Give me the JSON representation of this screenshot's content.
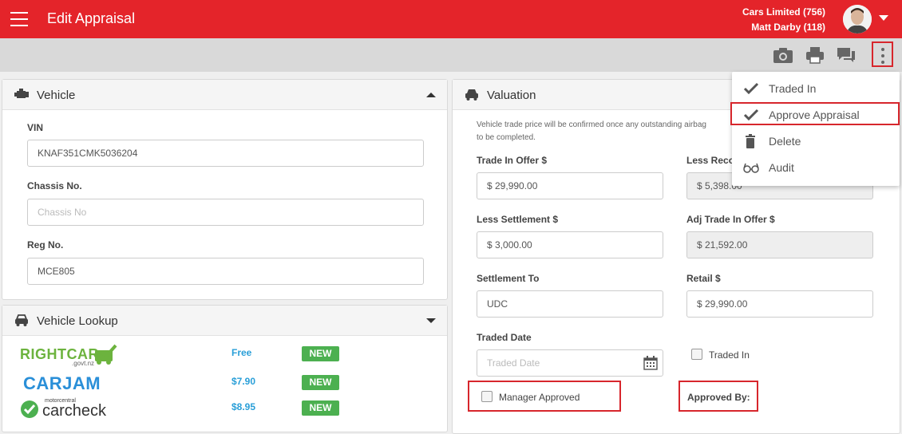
{
  "header": {
    "title": "Edit Appraisal",
    "company": "Cars Limited (756)",
    "user": "Matt Darby (118)"
  },
  "toolbar": {
    "icons": [
      "camera-icon",
      "print-icon",
      "comments-icon",
      "more-vertical-icon"
    ]
  },
  "vehicle": {
    "title": "Vehicle",
    "vin_label": "VIN",
    "vin_value": "KNAF351CMK5036204",
    "chassis_label": "Chassis No.",
    "chassis_placeholder": "Chassis No",
    "reg_label": "Reg No.",
    "reg_value": "MCE805"
  },
  "lookup": {
    "title": "Vehicle Lookup",
    "providers": [
      {
        "name": "RIGHTCAR",
        "sub": ".govt.nz",
        "price": "Free",
        "badge": "NEW"
      },
      {
        "name": "CARJAM",
        "price": "$7.90",
        "badge": "NEW"
      },
      {
        "name": "carcheck",
        "sub": "motorcentral",
        "price": "$8.95",
        "badge": "NEW"
      }
    ]
  },
  "valuation": {
    "title": "Valuation",
    "note_line1": "Vehicle trade price will be confirmed once any outstanding airbag",
    "note_line2": "to be completed.",
    "trade_in_offer_label": "Trade In Offer $",
    "trade_in_offer_value": "$ 29,990.00",
    "less_recon_label": "Less Reco",
    "less_recon_value": "$ 5,398.00",
    "less_settlement_label": "Less Settlement $",
    "less_settlement_value": "$ 3,000.00",
    "adj_trade_label": "Adj Trade In Offer $",
    "adj_trade_value": "$ 21,592.00",
    "settlement_to_label": "Settlement To",
    "settlement_to_value": "UDC",
    "retail_label": "Retail $",
    "retail_value": "$ 29,990.00",
    "traded_date_label": "Traded Date",
    "traded_date_placeholder": "Traded Date",
    "traded_in_label": "Traded In",
    "manager_approved_label": "Manager Approved",
    "approved_by_label": "Approved By:"
  },
  "menu": {
    "items": [
      {
        "label": "Traded In",
        "icon": "check-icon"
      },
      {
        "label": "Approve Appraisal",
        "icon": "check-icon"
      },
      {
        "label": "Delete",
        "icon": "trash-icon"
      },
      {
        "label": "Audit",
        "icon": "glasses-icon"
      }
    ]
  },
  "colors": {
    "brand_red": "#e4242a",
    "new_badge": "#4cb050",
    "price_blue": "#2a9fd8",
    "highlight_red": "#d7262c"
  }
}
